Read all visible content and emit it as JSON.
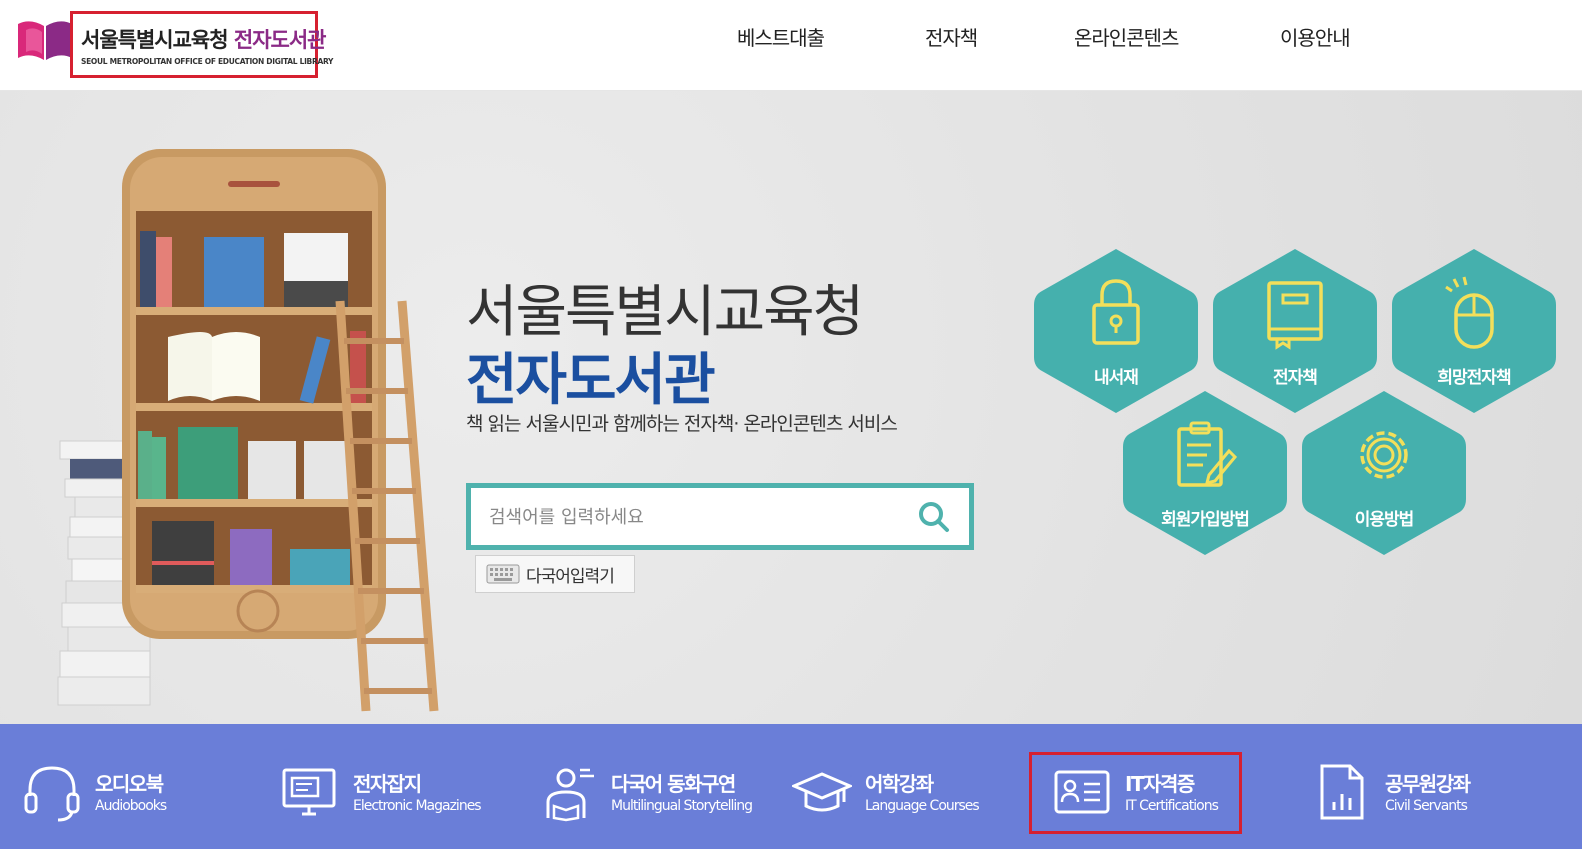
{
  "header": {
    "logo_title": "서울특별시교육청 ",
    "logo_title_accent": "전자도서관",
    "logo_sub": "SEOUL METROPOLITAN OFFICE OF EDUCATION DIGITAL LIBRARY",
    "nav": [
      {
        "label": "베스트대출"
      },
      {
        "label": "전자책"
      },
      {
        "label": "온라인콘텐츠"
      },
      {
        "label": "이용안내"
      }
    ]
  },
  "hero": {
    "title_line1": "서울특별시교육청",
    "title_line2": "전자도서관",
    "subtitle": "책 읽는 서울시민과 함께하는 전자책· 온라인콘텐츠 서비스",
    "search": {
      "placeholder": "검색어를 입력하세요",
      "value": ""
    },
    "ime_button": "다국어입력기"
  },
  "quick_menu": [
    {
      "label": "내서재",
      "icon": "lock-icon"
    },
    {
      "label": "전자책",
      "icon": "book-icon"
    },
    {
      "label": "희망전자책",
      "icon": "mouse-icon"
    },
    {
      "label": "회원가입방법",
      "icon": "clipboard-pencil-icon"
    },
    {
      "label": "이용방법",
      "icon": "gear-icon"
    }
  ],
  "services": [
    {
      "title": "오디오북",
      "subtitle": "Audiobooks",
      "icon": "headphones-icon"
    },
    {
      "title": "전자잡지",
      "subtitle": "Electronic Magazines",
      "icon": "monitor-icon"
    },
    {
      "title": "다국어 동화구연",
      "subtitle": "Multilingual Storytelling",
      "icon": "reader-icon"
    },
    {
      "title": "어학강좌",
      "subtitle": "Language Courses",
      "icon": "graduation-cap-icon"
    },
    {
      "title": "IT자격증",
      "subtitle": "IT Certifications",
      "icon": "id-card-icon"
    },
    {
      "title": "공무원강좌",
      "subtitle": "Civil Servants",
      "icon": "document-chart-icon"
    }
  ],
  "colors": {
    "brand_blue": "#1b4fa0",
    "teal": "#4fb2ad",
    "hex_fill": "#45b0ad",
    "icon_yellow": "#f3df5a",
    "bottom_bar": "#6a7ed8",
    "highlight_red": "#d62030",
    "logo_purple": "#8b2a86"
  }
}
